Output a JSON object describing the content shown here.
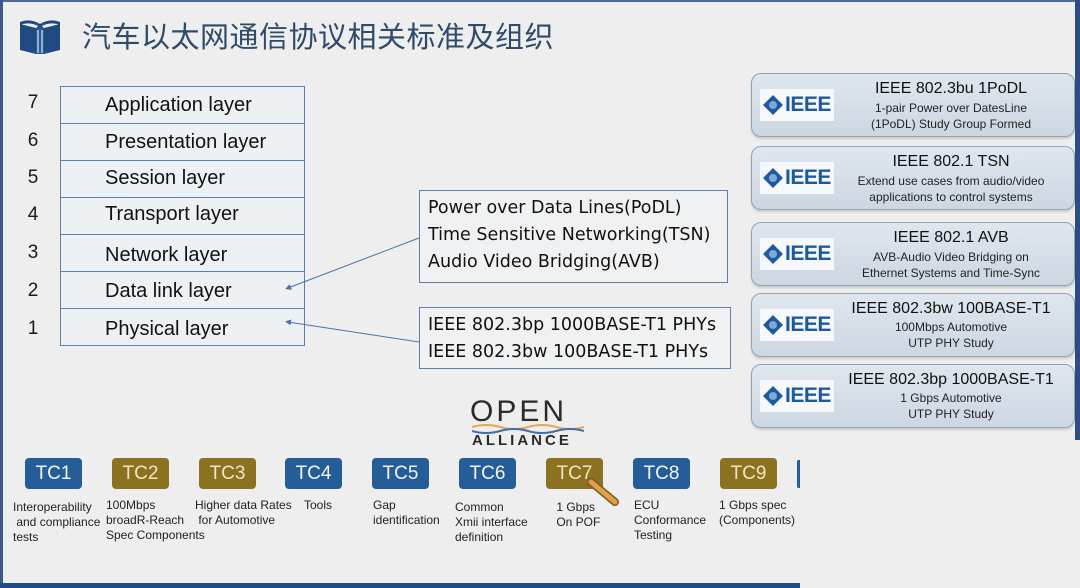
{
  "title": "汽车以太网通信协议相关标准及组织",
  "title_icon": "open-book-icon",
  "osi_layers": [
    {
      "number": "7",
      "name": "Application layer"
    },
    {
      "number": "6",
      "name": "Presentation layer"
    },
    {
      "number": "5",
      "name": "Session layer"
    },
    {
      "number": "4",
      "name": "Transport layer"
    },
    {
      "number": "3",
      "name": "Network layer"
    },
    {
      "number": "2",
      "name": "Data link layer"
    },
    {
      "number": "1",
      "name": "Physical layer"
    }
  ],
  "datalink_protocols": [
    "Power over Data Lines(PoDL)",
    "Time Sensitive Networking(TSN)",
    "Audio Video Bridging(AVB)"
  ],
  "physical_protocols": [
    "IEEE 802.3bp 1000BASE-T1 PHYs",
    "IEEE 802.3bw 100BASE-T1 PHYs"
  ],
  "ieee_logo_text": "IEEE",
  "ieee_cards": [
    {
      "title": "IEEE 802.3bu 1PoDL",
      "line1": "1-pair Power over DatesLine",
      "line2": "(1PoDL) Study Group Formed"
    },
    {
      "title": "IEEE 802.1 TSN",
      "line1": "Extend use cases from audio/video",
      "line2": "applications to control systems"
    },
    {
      "title": "IEEE 802.1 AVB",
      "line1": "AVB-Audio Video Bridging on",
      "line2": "Ethernet Systems and Time-Sync"
    },
    {
      "title": "IEEE 802.3bw 100BASE-T1",
      "line1": "100Mbps Automotive",
      "line2": "UTP PHY Study"
    },
    {
      "title": "IEEE 802.3bp 1000BASE-T1",
      "line1": "1 Gbps Automotive",
      "line2": "UTP PHY Study"
    }
  ],
  "open_alliance": {
    "line1": "OPEN",
    "line2": "ALLIANCE"
  },
  "technical_committees": [
    {
      "label": "TC1",
      "color": "#245d98",
      "desc": "Interoperability\n and compliance\ntests"
    },
    {
      "label": "TC2",
      "color": "#8b7120",
      "desc": "100Mbps\nbroadR-Reach\nSpec Components"
    },
    {
      "label": "TC3",
      "color": "#8b7120",
      "desc": "Higher data Rates\n for Automotive"
    },
    {
      "label": "TC4",
      "color": "#245d98",
      "desc": "Tools"
    },
    {
      "label": "TC5",
      "color": "#245d98",
      "desc": "Gap\nidentification"
    },
    {
      "label": "TC6",
      "color": "#245d98",
      "desc": "Common\nXmii interface\ndefinition"
    },
    {
      "label": "TC7",
      "color": "#8b7120",
      "desc": " 1 Gbps\n On POF"
    },
    {
      "label": "TC8",
      "color": "#245d98",
      "desc": "ECU\nConformance\nTesting"
    },
    {
      "label": "TC9",
      "color": "#8b7120",
      "desc": "1 Gbps spec\n(Components)"
    }
  ],
  "colors": {
    "tc_blue": "#245d98",
    "tc_gold": "#8b7120",
    "title": "#2f4a6b",
    "ieee_blue": "#1c5a9c"
  }
}
